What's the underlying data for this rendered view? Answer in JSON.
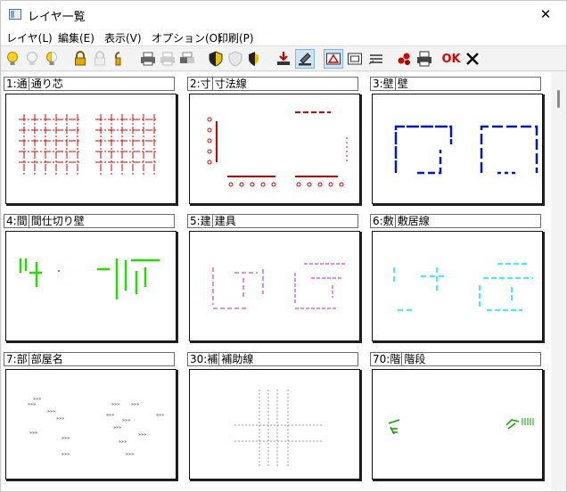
{
  "window": {
    "title": "レイヤ一覧",
    "close_glyph": "✕"
  },
  "menu": [
    {
      "label": "レイヤ(L)"
    },
    {
      "label": "編集(E)"
    },
    {
      "label": "表示(V)"
    },
    {
      "label": "オプション(O)"
    },
    {
      "label": "印刷(P)"
    }
  ],
  "toolbar": {
    "ok_label": "OK",
    "icons": [
      "bulb-on-icon",
      "bulb-off-icon",
      "bulb-half-icon",
      "lock-icon",
      "unlock-icon",
      "lock-half-icon",
      "print-icon",
      "print-disabled-icon",
      "print-half-icon",
      "shield-icon",
      "shield-disabled-icon",
      "shield-half-icon",
      "download-icon",
      "edit-icon",
      "layer-view-icon",
      "frame-icon",
      "list-icon",
      "color-icon",
      "printer-icon",
      "ok-button",
      "cancel-x-icon"
    ]
  },
  "layers": [
    {
      "prefix": "1:通",
      "name": "通り芯",
      "color": "#d40000"
    },
    {
      "prefix": "2:寸",
      "name": "寸法線",
      "color": "#d40000"
    },
    {
      "prefix": "3:壁",
      "name": "壁",
      "color": "#0018c8"
    },
    {
      "prefix": "4:間",
      "name": "間仕切り壁",
      "color": "#22dd00"
    },
    {
      "prefix": "5:建",
      "name": "建具",
      "color": "#c818c8"
    },
    {
      "prefix": "6:敷",
      "name": "敷居線",
      "color": "#00e8f0"
    },
    {
      "prefix": "7:部",
      "name": "部屋名",
      "color": "#111111"
    },
    {
      "prefix": "30:補",
      "name": "補助線",
      "color": "#9a9a9a"
    },
    {
      "prefix": "70:階",
      "name": "階段",
      "color": "#0aa000"
    }
  ]
}
